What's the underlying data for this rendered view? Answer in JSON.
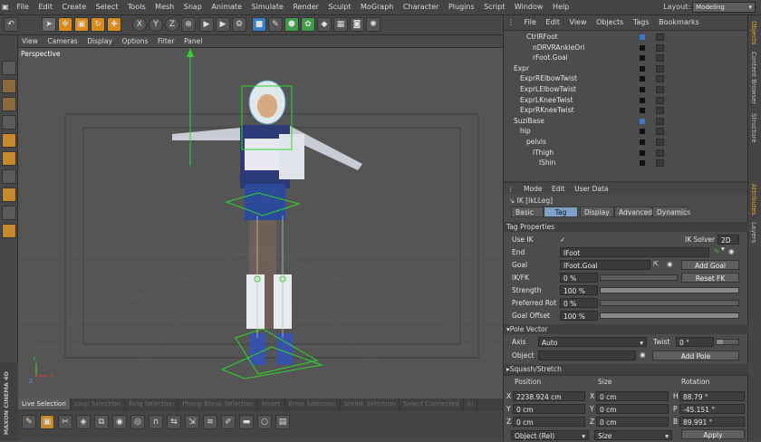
{
  "menubar": {
    "items": [
      "File",
      "Edit",
      "Create",
      "Select",
      "Tools",
      "Mesh",
      "Snap",
      "Animate",
      "Simulate",
      "Render",
      "Sculpt",
      "MoGraph",
      "Character",
      "Plugins",
      "Script",
      "Window",
      "Help"
    ],
    "layout_label": "Layout:",
    "layout_value": "Modeling"
  },
  "toolbar": {
    "icons": [
      "undo-icon",
      "select-arrow-icon",
      "move-icon",
      "scale-icon",
      "rotate-icon",
      "move-axes-icon",
      "x-axis-icon",
      "y-axis-icon",
      "z-axis-icon",
      "coordinate-system-icon",
      "render-view-icon",
      "render-picture-icon",
      "render-settings-icon",
      "cube-icon",
      "pen-icon",
      "subdivision-icon",
      "array-icon",
      "light-icon"
    ],
    "axis_labels": [
      "X",
      "Y",
      "Z"
    ]
  },
  "viewport": {
    "menu": [
      "View",
      "Cameras",
      "Display",
      "Options",
      "Filter",
      "Panel"
    ],
    "label": "Perspective"
  },
  "bottombar": {
    "tools": [
      "Live Selection",
      "Loop Selection",
      "Ring Selection",
      "Phong Break Selection",
      "Invert",
      "Brow Selection",
      "Shrink Selection",
      "Select Connected",
      "In"
    ]
  },
  "brand": {
    "logo_text": "MAXON CINEMA 4D"
  },
  "object_manager": {
    "menu": [
      "File",
      "Edit",
      "View",
      "Objects",
      "Tags",
      "Bookmarks"
    ],
    "rows": [
      {
        "name": "CtrlRFoot",
        "indent": 3,
        "color": "blue"
      },
      {
        "name": "nDRVRAnkleOri",
        "indent": 4,
        "color": "black"
      },
      {
        "name": "rFoot.Goal",
        "indent": 4,
        "color": "black"
      },
      {
        "name": "Expr",
        "indent": 1,
        "color": "black"
      },
      {
        "name": "ExprRElbowTwist",
        "indent": 2,
        "color": "black"
      },
      {
        "name": "ExprLElbowTwist",
        "indent": 2,
        "color": "black"
      },
      {
        "name": "ExprLKneeTwist",
        "indent": 2,
        "color": "black"
      },
      {
        "name": "ExprRKneeTwist",
        "indent": 2,
        "color": "black"
      },
      {
        "name": "SuziBase",
        "indent": 1,
        "color": "blue"
      },
      {
        "name": "hip",
        "indent": 2,
        "color": "black"
      },
      {
        "name": "pelvis",
        "indent": 3,
        "color": "black"
      },
      {
        "name": "lThigh",
        "indent": 4,
        "color": "black"
      },
      {
        "name": "lShin",
        "indent": 5,
        "color": "black"
      }
    ]
  },
  "side_tabs": {
    "top": [
      "Objects",
      "Content Browser",
      "Structure"
    ],
    "bottom": [
      "Attributes",
      "Layers"
    ]
  },
  "attributes": {
    "menu": [
      "Mode",
      "Edit",
      "User Data"
    ],
    "title": "IK [lkLLeg]",
    "tabs": [
      "Basic",
      "Tag",
      "Display",
      "Advanced",
      "Dynamics"
    ],
    "active_tab": "Tag",
    "section_tag_props": "Tag Properties",
    "use_ik_label": "Use IK",
    "use_ik_value": "✓",
    "ik_solver_label": "IK Solver",
    "ik_solver_value": "2D",
    "end_label": "End",
    "end_value": "lFoot",
    "goal_label": "Goal",
    "goal_value": "lFoot.Goal",
    "add_goal": "Add Goal",
    "ikfk_label": "IK/FK",
    "ikfk_value": "0 %",
    "ikfk_fraction": 0.0,
    "reset_fk": "Reset FK",
    "strength_label": "Strength",
    "strength_value": "100 %",
    "strength_fraction": 1.0,
    "pref_rot_label": "Preferred Rot",
    "pref_rot_value": "0 %",
    "pref_rot_fraction": 0.0,
    "goal_offset_label": "Goal Offset",
    "goal_offset_value": "100 %",
    "goal_offset_fraction": 1.0,
    "section_pole": "Pole Vector",
    "axis_label": "Axis",
    "axis_value": "Auto",
    "twist_label": "Twist",
    "twist_value": "0 °",
    "object_label": "Object",
    "object_value": "",
    "add_pole": "Add Pole",
    "section_squash": "Squash/Stretch"
  },
  "coordinates": {
    "headers": [
      "Position",
      "Size",
      "Rotation"
    ],
    "rows": [
      {
        "axis": "X",
        "pos": "2238.924 cm",
        "saxis": "X",
        "size": "0 cm",
        "raxis": "H",
        "rot": "88.79 °"
      },
      {
        "axis": "Y",
        "pos": "0 cm",
        "saxis": "Y",
        "size": "0 cm",
        "raxis": "P",
        "rot": "-45.151 °"
      },
      {
        "axis": "Z",
        "pos": "0 cm",
        "saxis": "Z",
        "size": "0 cm",
        "raxis": "B",
        "rot": "89.991 °"
      }
    ],
    "mode_value": "Object (Rel)",
    "size_mode_value": "Size",
    "apply": "Apply"
  },
  "colors": {
    "accent_tab": "#7fa0c8",
    "blue_dot": "#3a79c6",
    "active_side_tab": "#e8a52b",
    "viewport_bg": "#555555"
  }
}
